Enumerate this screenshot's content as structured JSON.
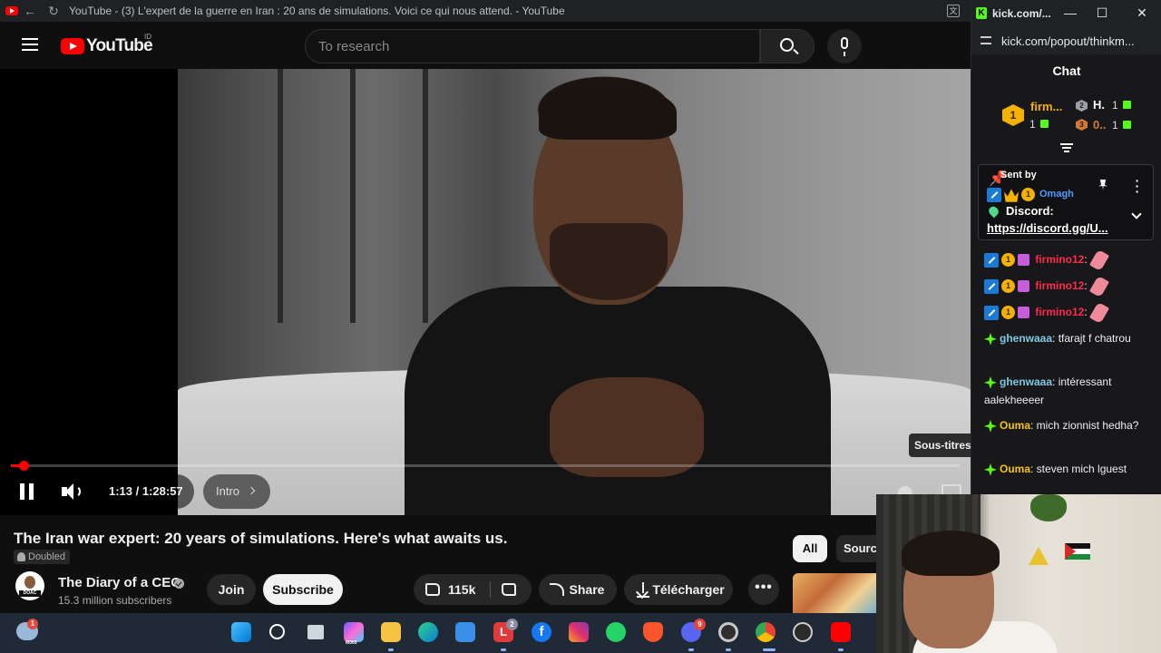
{
  "browser": {
    "tab_title": "YouTube - (3) L'expert de la guerre en Iran : 20 ans de simulations. Voici ce qui nous attend. - YouTube",
    "back_glyph": "←",
    "reload_glyph": "↻"
  },
  "youtube": {
    "logo_text": "YouTube",
    "region": "ID",
    "search_placeholder": "To research",
    "player": {
      "time": "1:13 / 1:28:57",
      "chapter": "Intro",
      "subtitles_tooltip": "Sous-titres",
      "progress_fraction": 0.0137,
      "paused": false
    },
    "video_title": "The Iran war expert: 20 years of simulations. Here's what awaits us.",
    "dubbed_label": "Doubled",
    "channel": {
      "name": "The Diary of a CEO",
      "avatar_tag": "DOAC",
      "subscribers": "15.3 million subscribers",
      "verified": true
    },
    "actions": {
      "join": "Join",
      "subscribe": "Subscribe",
      "likes": "115k",
      "share": "Share",
      "download": "Télécharger",
      "more": "•••"
    },
    "chips": {
      "all": "All",
      "source": "Sources"
    }
  },
  "kick": {
    "window_title": "kick.com/...",
    "url": "kick.com/popout/thinkm...",
    "minimize": "—",
    "maximize": "☐",
    "close": "✕",
    "chat_heading": "Chat",
    "leaderboard": [
      {
        "rank": "1",
        "name": "firm...",
        "count": "1"
      },
      {
        "rank": "2",
        "name": "H.",
        "count": "1"
      },
      {
        "rank": "3",
        "name": "0..",
        "count": "1"
      }
    ],
    "pinned": {
      "label": "Sent by",
      "author": "Omagh",
      "badge_one": "1",
      "heading": "Discord:",
      "link": "https://discord.gg/U..."
    },
    "messages": [
      {
        "user": "firmino12",
        "text": ":",
        "style": "red",
        "emote": true
      },
      {
        "user": "firmino12",
        "text": ":",
        "style": "red",
        "emote": true
      },
      {
        "user": "firmino12",
        "text": ":",
        "style": "red",
        "emote": true
      },
      {
        "user": "ghenwaaa",
        "text": ": tfarajt f chatrou",
        "style": "blue"
      },
      {
        "user": "ghenwaaa",
        "text": ": intéressant aalekheeeer",
        "style": "blue"
      },
      {
        "user": "Ouma",
        "text": ": mich zionnist hedha?",
        "style": "yellow"
      },
      {
        "user": "Ouma",
        "text": ": steven mich lguest",
        "style": "yellow"
      }
    ]
  },
  "taskbar": {
    "weather_badge": "1",
    "icons": [
      "windows-start-icon",
      "search-icon",
      "task-view-icon",
      "m365-icon",
      "file-explorer-icon",
      "edge-icon",
      "store-icon",
      "l-app-icon",
      "facebook-icon",
      "instagram-icon",
      "whatsapp-icon",
      "brave-icon",
      "discord-icon",
      "obs-icon",
      "chrome-icon",
      "media-player-icon",
      "youtube-app-icon"
    ],
    "l_app_badge": "2",
    "discord_badge": "9",
    "m365_label": "M365"
  },
  "colors": {
    "youtube_red": "#ff0000",
    "kick_green": "#53fc18",
    "taskbar_bg": "#1f2a36",
    "chat_bg": "#18181b"
  }
}
